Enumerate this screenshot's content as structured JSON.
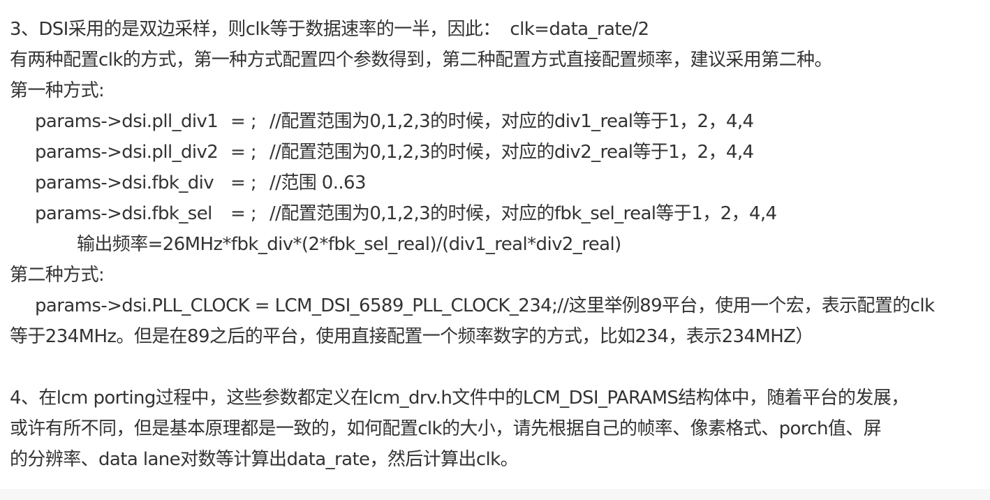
{
  "section3": {
    "heading": "3、DSI采用的是双边采样，则clk等于数据速率的一半，因此：",
    "formula": "clk=data_rate/2",
    "intro": "有两种配置clk的方式，第一种方式配置四个参数得到，第二种配置方式直接配置频率，建议采用第二种。",
    "method1_title": "第一种方式:",
    "params": [
      {
        "code": "params->dsi.pll_div1",
        "assign": "= ;",
        "comment": "//配置范围为0,1,2,3的时候，对应的div1_real等于1，2，4,4"
      },
      {
        "code": "params->dsi.pll_div2",
        "assign": "= ;",
        "comment": "//配置范围为0,1,2,3的时候，对应的div2_real等于1，2，4,4"
      },
      {
        "code": "params->dsi.fbk_div",
        "assign": "= ;",
        "comment": "//范围 0..63"
      },
      {
        "code": "params->dsi.fbk_sel",
        "assign": "= ;",
        "comment": "//配置范围为0,1,2,3的时候，对应的fbk_sel_real等于1，2，4,4"
      }
    ],
    "output_freq": "输出频率=26MHz*fbk_div*(2*fbk_sel_real)/(div1_real*div2_real)",
    "method2_title": "第二种方式:",
    "method2_line1": "params->dsi.PLL_CLOCK = LCM_DSI_6589_PLL_CLOCK_234;//这里举例89平台，使用一个宏，表示配置的clk",
    "method2_line2": "等于234MHz。但是在89之后的平台，使用直接配置一个频率数字的方式，比如234，表示234MHZ）"
  },
  "section4": {
    "line1": "4、在lcm porting过程中，这些参数都定义在lcm_drv.h文件中的LCM_DSI_PARAMS结构体中，随着平台的发展，",
    "line2": "或许有所不同，但是基本原理都是一致的，如何配置clk的大小，请先根据自己的帧率、像素格式、porch值、屏",
    "line3": "的分辨率、data lane对数等计算出data_rate，然后计算出clk。"
  }
}
